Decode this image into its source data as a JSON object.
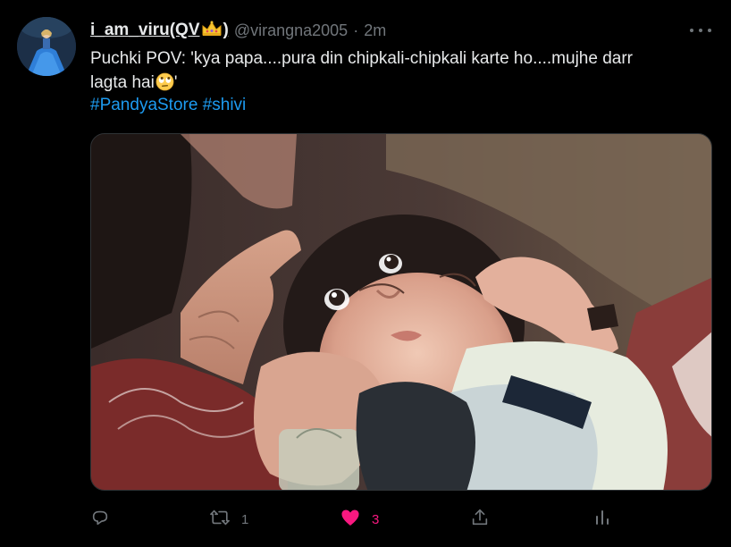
{
  "tweet": {
    "display_name": "i_am_viru(QV",
    "display_name_close": ")",
    "handle": "@virangna2005",
    "separator": "·",
    "timestamp": "2m",
    "text_line1": "Puchki POV: 'kya papa....pura din chipkali-chipkali karte ho....mujhe darr",
    "text_line2_start": "lagta hai",
    "text_line2_end": "'",
    "hashtags": [
      "#PandyaStore",
      "#shivi"
    ],
    "emoji_name": "face-with-rolling-eyes-icon",
    "crown_emoji": "crown-icon"
  },
  "actions": {
    "reply_count": "",
    "retweet_count": "1",
    "like_count": "3",
    "liked": true
  },
  "colors": {
    "background": "#000000",
    "text": "#e7e9ea",
    "muted": "#71767b",
    "link": "#1d9bf0",
    "like": "#f91880"
  }
}
